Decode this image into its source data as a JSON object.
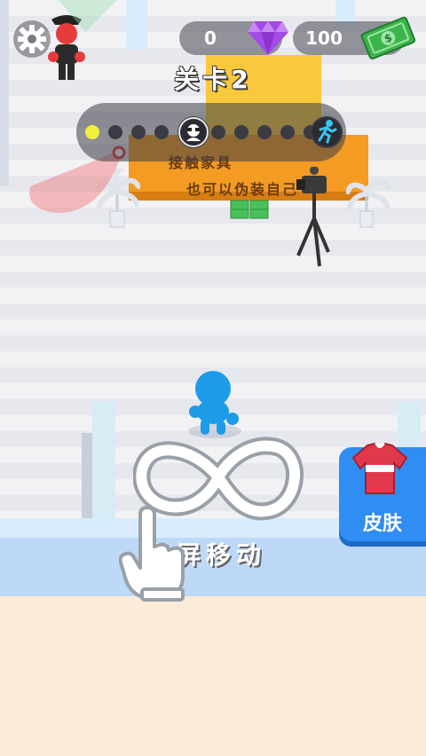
{
  "hud": {
    "gems": "0",
    "cash": "100",
    "level_title": "关卡2"
  },
  "progress": {
    "total_dots": 10,
    "current_index": 0
  },
  "hints": {
    "line1": "接触家具",
    "line2": "也可以伪装自己"
  },
  "buttons": {
    "skin_label": "皮肤"
  },
  "tutorial": {
    "text": "滑屏移动"
  },
  "colors": {
    "player": "#1e9be8",
    "guard": "#e53b3b",
    "gem": "#a34be6",
    "cash": "#3bb54a",
    "skin_button": "#2f8df4"
  },
  "icons": {
    "settings": "gear-icon",
    "gem": "gem-icon",
    "cash": "cash-icon",
    "guard_marker": "guard-face-icon",
    "goal_marker": "running-man-icon",
    "skin": "shirt-icon",
    "hand": "pointer-hand-icon",
    "swipe": "infinity-swipe-icon"
  }
}
